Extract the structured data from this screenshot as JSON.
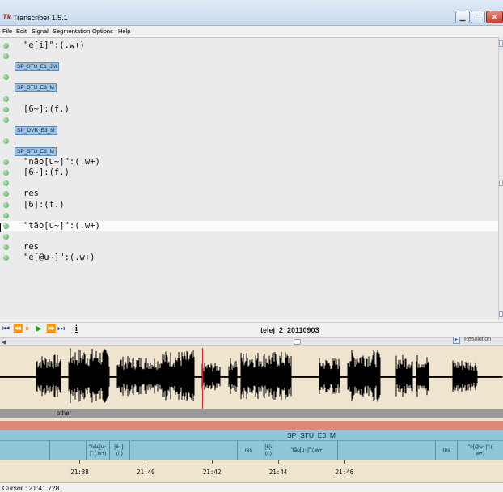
{
  "window": {
    "title": "Transcriber 1.5.1",
    "icon_text": "Tk"
  },
  "menu": [
    "File",
    "Edit",
    "Signal",
    "Segmentation",
    "Options",
    "Help"
  ],
  "editor": {
    "lines": [
      {
        "kind": "text",
        "text": "\"e[i]\":(.w+)"
      },
      {
        "kind": "empty"
      },
      {
        "kind": "speaker",
        "text": "SP_STU_E1_JM"
      },
      {
        "kind": "empty"
      },
      {
        "kind": "speaker",
        "text": "SP_STU_E3_M"
      },
      {
        "kind": "empty"
      },
      {
        "kind": "text",
        "text": "[6~]:(f.)"
      },
      {
        "kind": "empty"
      },
      {
        "kind": "speaker",
        "text": "SP_DVR_E3_M"
      },
      {
        "kind": "empty"
      },
      {
        "kind": "speaker",
        "text": "SP_STU_E3_M"
      },
      {
        "kind": "text",
        "text": "\"não[u~]\":(.w+)"
      },
      {
        "kind": "text",
        "text": "[6~]:(f.)"
      },
      {
        "kind": "empty"
      },
      {
        "kind": "text",
        "text": "res"
      },
      {
        "kind": "text",
        "text": "[6]:(f.)"
      },
      {
        "kind": "empty"
      },
      {
        "kind": "text",
        "text": "\"tão[u~]\":(.w+)",
        "active": true
      },
      {
        "kind": "empty"
      },
      {
        "kind": "text",
        "text": "res"
      },
      {
        "kind": "text",
        "text": "\"e[@u~]\":(.w+)"
      }
    ]
  },
  "toolbar": {
    "buttons": [
      {
        "name": "rewind-start-icon",
        "glyph": "⏮",
        "color": "#1f3f86"
      },
      {
        "name": "rewind-icon",
        "glyph": "⏪",
        "color": "#1f3f86"
      },
      {
        "name": "pause-icon",
        "glyph": "⏸",
        "color": "#e8a55a"
      },
      {
        "name": "play-icon",
        "glyph": "▶",
        "color": "#2e9b2e"
      },
      {
        "name": "fast-forward-icon",
        "glyph": "⏩",
        "color": "#1f3f86"
      },
      {
        "name": "forward-end-icon",
        "glyph": "⏭",
        "color": "#1f3f86"
      },
      {
        "name": "info-icon",
        "glyph": "i",
        "color": "#000000"
      }
    ],
    "filename": "telej_2_20110903"
  },
  "resolution_label": "Resolution",
  "tiers": {
    "topic": "other",
    "speaker": "SP_STU_E3_M",
    "segments": [
      {
        "text": "",
        "time": 21.371,
        "to": 21.382
      },
      {
        "text": "\"não[u~\n]\":(.w+)",
        "time": 21.382,
        "to": 21.389
      },
      {
        "text": "[6~]:\n(f.)",
        "time": 21.389,
        "to": 21.395
      },
      {
        "text": "",
        "time": 21.395,
        "to": 21.4275
      },
      {
        "text": "res",
        "time": 21.4275,
        "to": 21.4345
      },
      {
        "text": "[6]:\n(f.)",
        "time": 21.4345,
        "to": 21.4395
      },
      {
        "text": "\"tão[u~]\":(.w+)",
        "time": 21.4395,
        "to": 21.458
      },
      {
        "text": "",
        "time": 21.458,
        "to": 21.4875
      },
      {
        "text": "res",
        "time": 21.4875,
        "to": 21.494
      },
      {
        "text": "\"e[@u~]\":(\nw+)",
        "time": 21.494,
        "to": 21.508
      }
    ]
  },
  "time_axis": {
    "start": 21.356,
    "end": 21.508,
    "ticks": [
      "21:38",
      "21:40",
      "21:42",
      "21:44",
      "21:46"
    ],
    "tick_values": [
      21.38,
      21.4,
      21.42,
      21.44,
      21.46
    ]
  },
  "cursor_time": 21.4172,
  "status": {
    "cursor": "Cursor : 21:41.728"
  }
}
